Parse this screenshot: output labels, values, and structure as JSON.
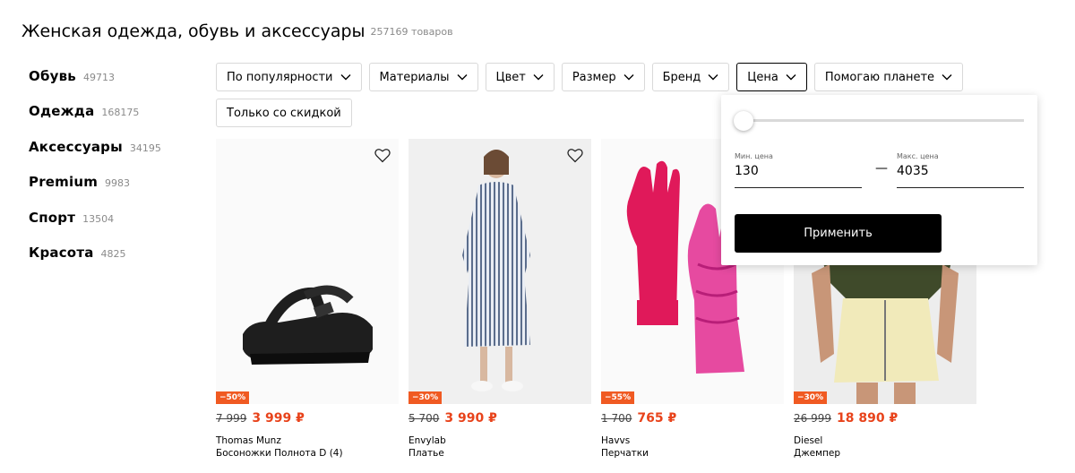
{
  "header": {
    "title": "Женская одежда, обувь и аксессуары",
    "count": "257169 товаров"
  },
  "sidebar": {
    "items": [
      {
        "label": "Обувь",
        "count": "49713"
      },
      {
        "label": "Одежда",
        "count": "168175"
      },
      {
        "label": "Аксессуары",
        "count": "34195"
      },
      {
        "label": "Premium",
        "count": "9983"
      },
      {
        "label": "Спорт",
        "count": "13504"
      },
      {
        "label": "Красота",
        "count": "4825"
      }
    ]
  },
  "filters": {
    "sort": "По популярности",
    "materials": "Материалы",
    "color": "Цвет",
    "size": "Размер",
    "brand": "Бренд",
    "price": "Цена",
    "planet": "Помогаю планете",
    "discount_only": "Только со скидкой"
  },
  "price_popup": {
    "min_label": "Мин. цена",
    "max_label": "Макс. цена",
    "min_value": "130",
    "max_value": "4035",
    "dash": "—",
    "apply_label": "Применить"
  },
  "products": [
    {
      "discount": "−50%",
      "old_price": "7 999",
      "new_price": "3 999 ₽",
      "brand": "Thomas Munz",
      "type": "Босоножки Полнота D (4)"
    },
    {
      "discount": "−30%",
      "old_price": "5 700",
      "new_price": "3 990 ₽",
      "brand": "Envylab",
      "type": "Платье"
    },
    {
      "discount": "−55%",
      "old_price": "1 700",
      "new_price": "765 ₽",
      "brand": "Havvs",
      "type": "Перчатки"
    },
    {
      "discount": "−30%",
      "old_price": "26 999",
      "new_price": "18 890 ₽",
      "brand": "Diesel",
      "type": "Джемпер"
    }
  ],
  "colors": {
    "accent_price": "#e8431b",
    "discount_badge": "#f05a22",
    "apply_button": "#000000"
  }
}
